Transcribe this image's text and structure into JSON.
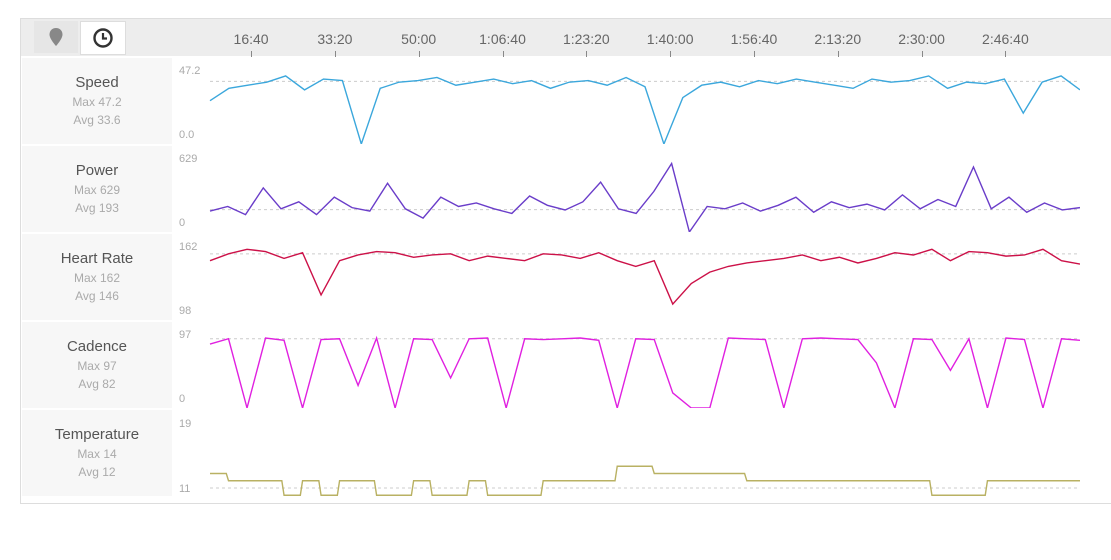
{
  "toolbar": {
    "map_icon": "map-pin-icon",
    "time_icon": "clock-icon"
  },
  "chart_data": {
    "type": "line",
    "x_axis": {
      "unit": "elapsed time (s)",
      "range": [
        510,
        10890
      ],
      "ticks": [
        {
          "t": 1000,
          "label": "16:40"
        },
        {
          "t": 2000,
          "label": "33:20"
        },
        {
          "t": 3000,
          "label": "50:00"
        },
        {
          "t": 4000,
          "label": "1:06:40"
        },
        {
          "t": 5000,
          "label": "1:23:20"
        },
        {
          "t": 6000,
          "label": "1:40:00"
        },
        {
          "t": 7000,
          "label": "1:56:40"
        },
        {
          "t": 8000,
          "label": "2:13:20"
        },
        {
          "t": 9000,
          "label": "2:30:00"
        },
        {
          "t": 10000,
          "label": "2:46:40"
        }
      ]
    },
    "series": [
      {
        "name": "Speed",
        "max_label": "Max 47.2",
        "avg_label": "Avg 33.6",
        "ymax_label": "47.2",
        "ymin_label": "0.0",
        "ylim": [
          0,
          47.2
        ],
        "avg": 40.5,
        "color": "#3ba7dc",
        "values": [
          28,
          36,
          38,
          40,
          44,
          35,
          42,
          41,
          0,
          36,
          40,
          41,
          43,
          38,
          40,
          42,
          39,
          41,
          36,
          40,
          41,
          38,
          43,
          37,
          0,
          30,
          38,
          40,
          37,
          41,
          39,
          42,
          40,
          38,
          36,
          42,
          40,
          41,
          44,
          36,
          40,
          39,
          42,
          20,
          40,
          44,
          35
        ]
      },
      {
        "name": "Power",
        "max_label": "Max 629",
        "avg_label": "Avg 193",
        "ymax_label": "629",
        "ymin_label": "0",
        "ylim": [
          0,
          629
        ],
        "avg": 193,
        "color": "#6a3dc9",
        "values": [
          180,
          220,
          150,
          380,
          200,
          260,
          150,
          300,
          210,
          180,
          420,
          200,
          120,
          300,
          220,
          250,
          200,
          160,
          310,
          230,
          190,
          260,
          430,
          200,
          160,
          350,
          590,
          0,
          220,
          200,
          250,
          180,
          230,
          300,
          170,
          260,
          210,
          240,
          190,
          320,
          200,
          280,
          220,
          560,
          200,
          300,
          170,
          250,
          190,
          210
        ]
      },
      {
        "name": "Heart Rate",
        "max_label": "Max 162",
        "avg_label": "Avg 146",
        "ymax_label": "162",
        "ymin_label": "98",
        "ylim": [
          98,
          162
        ],
        "avg": 156,
        "color": "#cc1148",
        "values": [
          150,
          156,
          160,
          158,
          152,
          157,
          120,
          150,
          155,
          158,
          157,
          153,
          155,
          156,
          150,
          154,
          152,
          150,
          156,
          155,
          152,
          157,
          150,
          145,
          150,
          112,
          130,
          140,
          145,
          148,
          150,
          152,
          155,
          150,
          153,
          148,
          152,
          157,
          155,
          160,
          150,
          158,
          157,
          154,
          155,
          160,
          150,
          147
        ]
      },
      {
        "name": "Cadence",
        "max_label": "Max 97",
        "avg_label": "Avg 82",
        "ymax_label": "97",
        "ymin_label": "0",
        "ylim": [
          0,
          97
        ],
        "avg": 92,
        "color": "#e020e0",
        "values": [
          85,
          92,
          0,
          93,
          90,
          0,
          91,
          92,
          30,
          93,
          0,
          92,
          91,
          40,
          92,
          93,
          0,
          92,
          91,
          92,
          93,
          90,
          0,
          92,
          91,
          20,
          0,
          0,
          93,
          92,
          91,
          0,
          92,
          93,
          92,
          91,
          60,
          0,
          92,
          91,
          50,
          92,
          0,
          93,
          91,
          0,
          92,
          90
        ]
      },
      {
        "name": "Temperature",
        "max_label": "Max 14",
        "avg_label": "Avg 12",
        "ymax_label": "19",
        "ymin_label": "11",
        "ylim": [
          11,
          19
        ],
        "avg": 11,
        "color": "#b9b163",
        "step": true,
        "values": [
          13,
          12,
          12,
          12,
          10,
          12,
          10,
          12,
          12,
          10,
          10,
          12,
          10,
          10,
          12,
          10,
          10,
          10,
          12,
          12,
          12,
          12,
          14,
          14,
          13,
          13,
          13,
          13,
          13,
          12,
          12,
          12,
          12,
          12,
          12,
          12,
          12,
          12,
          12,
          10,
          10,
          10,
          12,
          12,
          12,
          12,
          12,
          12
        ]
      }
    ]
  }
}
